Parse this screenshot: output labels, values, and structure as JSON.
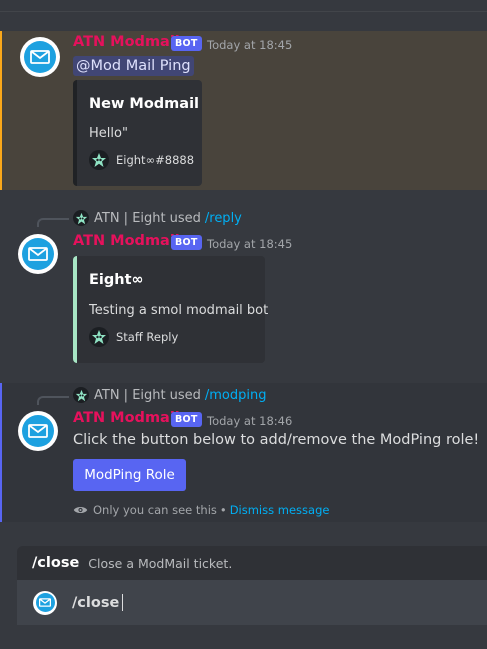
{
  "colors": {
    "background": "#36393f",
    "highlight_bg": "#49443c",
    "highlight_border": "#faa81a",
    "username": "#e6115c",
    "blurple": "#5865f2",
    "link": "#00aff4",
    "embed2_accent": "#a8e6c5"
  },
  "messages": [
    {
      "author": "ATN Modmail",
      "badge": "BOT",
      "timestamp": "Today at 18:45",
      "mention": "@Mod Mail Ping",
      "embed": {
        "title": "New Modmail",
        "description": "Hello\"",
        "footer": "Eight∞#8888"
      }
    },
    {
      "reply": {
        "user": "ATN | Eight",
        "used": "used",
        "command": "/reply"
      },
      "author": "ATN Modmail",
      "badge": "BOT",
      "timestamp": "Today at 18:45",
      "embed": {
        "title": "Eight∞",
        "description": "Testing a smol modmail bot",
        "footer": "Staff Reply"
      }
    },
    {
      "reply": {
        "user": "ATN | Eight",
        "used": "used",
        "command": "/modping"
      },
      "author": "ATN Modmail",
      "badge": "BOT",
      "timestamp": "Today at 18:46",
      "content": "Click the button below to add/remove the ModPing role!",
      "button": "ModPing Role",
      "ephemeral": {
        "notice": "Only you can see this",
        "separator": "•",
        "dismiss": "Dismiss message"
      }
    }
  ],
  "autocomplete": {
    "command": "/close",
    "description": "Close a ModMail ticket."
  },
  "input": {
    "value": "/close"
  },
  "icons": {
    "bot_avatar": "mail-envelope-icon",
    "user_avatar": "star-face-icon",
    "eye": "eye-icon"
  }
}
